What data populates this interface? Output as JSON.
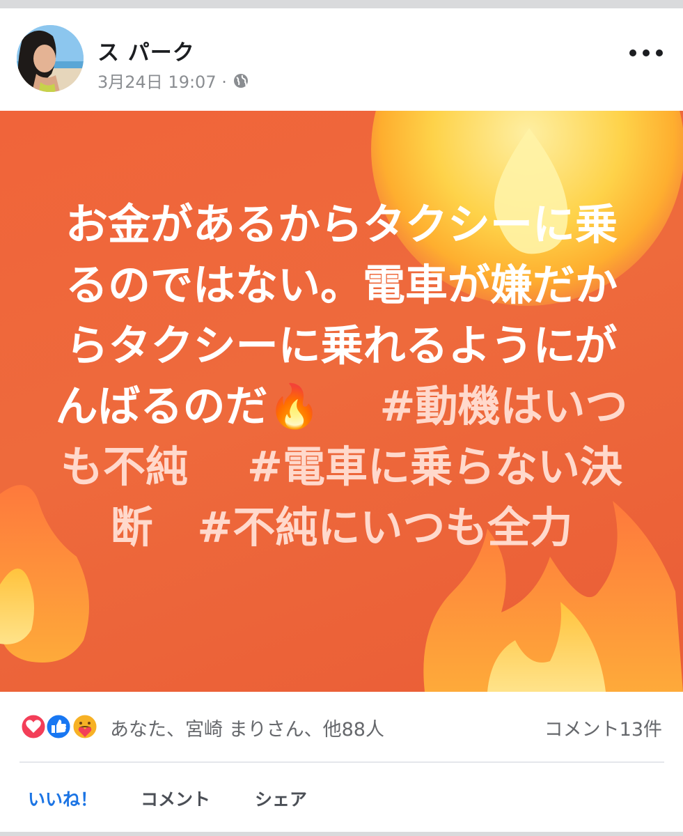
{
  "post": {
    "author": "ス パーク",
    "timestamp": "3月24日 19:07 ·",
    "privacy_icon": "globe-icon",
    "body_main": "お金があるからタクシーに乗るのではない。電車が嫌だからタクシーに乗れるようにがんばるのだ🔥",
    "hashtag_1": "#動機はいつも不純",
    "hashtag_2": "#電車に乗らない決断",
    "hashtag_3": "#不純にいつも全力",
    "background_color": "#ee6a3c"
  },
  "reactions": {
    "icons": [
      "love-icon",
      "like-icon",
      "care-icon"
    ],
    "summary": "あなた、宮崎 まりさん、他88人",
    "comment_count": "コメント13件"
  },
  "actions": {
    "like": "いいね！",
    "comment": "コメント",
    "share": "シェア"
  },
  "colors": {
    "accent": "#1b74e4",
    "text_secondary": "#65676b",
    "love": "#f33e58",
    "like": "#1877f2"
  }
}
